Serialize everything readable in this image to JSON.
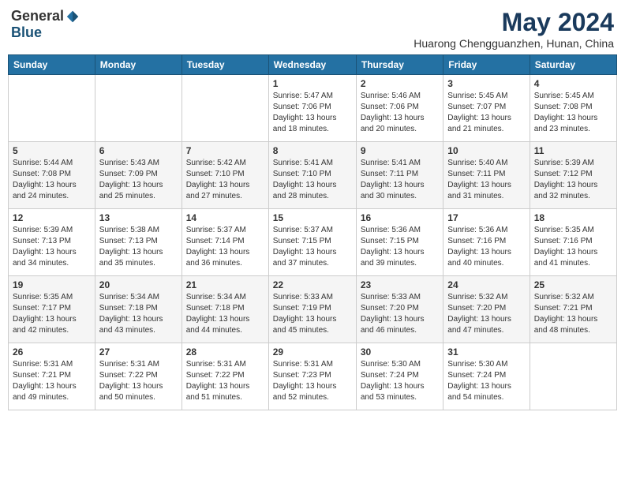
{
  "header": {
    "logo_general": "General",
    "logo_blue": "Blue",
    "main_title": "May 2024",
    "subtitle": "Huarong Chengguanzhen, Hunan, China"
  },
  "calendar": {
    "days_header": [
      "Sunday",
      "Monday",
      "Tuesday",
      "Wednesday",
      "Thursday",
      "Friday",
      "Saturday"
    ],
    "weeks": [
      [
        {
          "day": "",
          "info": ""
        },
        {
          "day": "",
          "info": ""
        },
        {
          "day": "",
          "info": ""
        },
        {
          "day": "1",
          "info": "Sunrise: 5:47 AM\nSunset: 7:06 PM\nDaylight: 13 hours\nand 18 minutes."
        },
        {
          "day": "2",
          "info": "Sunrise: 5:46 AM\nSunset: 7:06 PM\nDaylight: 13 hours\nand 20 minutes."
        },
        {
          "day": "3",
          "info": "Sunrise: 5:45 AM\nSunset: 7:07 PM\nDaylight: 13 hours\nand 21 minutes."
        },
        {
          "day": "4",
          "info": "Sunrise: 5:45 AM\nSunset: 7:08 PM\nDaylight: 13 hours\nand 23 minutes."
        }
      ],
      [
        {
          "day": "5",
          "info": "Sunrise: 5:44 AM\nSunset: 7:08 PM\nDaylight: 13 hours\nand 24 minutes."
        },
        {
          "day": "6",
          "info": "Sunrise: 5:43 AM\nSunset: 7:09 PM\nDaylight: 13 hours\nand 25 minutes."
        },
        {
          "day": "7",
          "info": "Sunrise: 5:42 AM\nSunset: 7:10 PM\nDaylight: 13 hours\nand 27 minutes."
        },
        {
          "day": "8",
          "info": "Sunrise: 5:41 AM\nSunset: 7:10 PM\nDaylight: 13 hours\nand 28 minutes."
        },
        {
          "day": "9",
          "info": "Sunrise: 5:41 AM\nSunset: 7:11 PM\nDaylight: 13 hours\nand 30 minutes."
        },
        {
          "day": "10",
          "info": "Sunrise: 5:40 AM\nSunset: 7:11 PM\nDaylight: 13 hours\nand 31 minutes."
        },
        {
          "day": "11",
          "info": "Sunrise: 5:39 AM\nSunset: 7:12 PM\nDaylight: 13 hours\nand 32 minutes."
        }
      ],
      [
        {
          "day": "12",
          "info": "Sunrise: 5:39 AM\nSunset: 7:13 PM\nDaylight: 13 hours\nand 34 minutes."
        },
        {
          "day": "13",
          "info": "Sunrise: 5:38 AM\nSunset: 7:13 PM\nDaylight: 13 hours\nand 35 minutes."
        },
        {
          "day": "14",
          "info": "Sunrise: 5:37 AM\nSunset: 7:14 PM\nDaylight: 13 hours\nand 36 minutes."
        },
        {
          "day": "15",
          "info": "Sunrise: 5:37 AM\nSunset: 7:15 PM\nDaylight: 13 hours\nand 37 minutes."
        },
        {
          "day": "16",
          "info": "Sunrise: 5:36 AM\nSunset: 7:15 PM\nDaylight: 13 hours\nand 39 minutes."
        },
        {
          "day": "17",
          "info": "Sunrise: 5:36 AM\nSunset: 7:16 PM\nDaylight: 13 hours\nand 40 minutes."
        },
        {
          "day": "18",
          "info": "Sunrise: 5:35 AM\nSunset: 7:16 PM\nDaylight: 13 hours\nand 41 minutes."
        }
      ],
      [
        {
          "day": "19",
          "info": "Sunrise: 5:35 AM\nSunset: 7:17 PM\nDaylight: 13 hours\nand 42 minutes."
        },
        {
          "day": "20",
          "info": "Sunrise: 5:34 AM\nSunset: 7:18 PM\nDaylight: 13 hours\nand 43 minutes."
        },
        {
          "day": "21",
          "info": "Sunrise: 5:34 AM\nSunset: 7:18 PM\nDaylight: 13 hours\nand 44 minutes."
        },
        {
          "day": "22",
          "info": "Sunrise: 5:33 AM\nSunset: 7:19 PM\nDaylight: 13 hours\nand 45 minutes."
        },
        {
          "day": "23",
          "info": "Sunrise: 5:33 AM\nSunset: 7:20 PM\nDaylight: 13 hours\nand 46 minutes."
        },
        {
          "day": "24",
          "info": "Sunrise: 5:32 AM\nSunset: 7:20 PM\nDaylight: 13 hours\nand 47 minutes."
        },
        {
          "day": "25",
          "info": "Sunrise: 5:32 AM\nSunset: 7:21 PM\nDaylight: 13 hours\nand 48 minutes."
        }
      ],
      [
        {
          "day": "26",
          "info": "Sunrise: 5:31 AM\nSunset: 7:21 PM\nDaylight: 13 hours\nand 49 minutes."
        },
        {
          "day": "27",
          "info": "Sunrise: 5:31 AM\nSunset: 7:22 PM\nDaylight: 13 hours\nand 50 minutes."
        },
        {
          "day": "28",
          "info": "Sunrise: 5:31 AM\nSunset: 7:22 PM\nDaylight: 13 hours\nand 51 minutes."
        },
        {
          "day": "29",
          "info": "Sunrise: 5:31 AM\nSunset: 7:23 PM\nDaylight: 13 hours\nand 52 minutes."
        },
        {
          "day": "30",
          "info": "Sunrise: 5:30 AM\nSunset: 7:24 PM\nDaylight: 13 hours\nand 53 minutes."
        },
        {
          "day": "31",
          "info": "Sunrise: 5:30 AM\nSunset: 7:24 PM\nDaylight: 13 hours\nand 54 minutes."
        },
        {
          "day": "",
          "info": ""
        }
      ]
    ]
  }
}
